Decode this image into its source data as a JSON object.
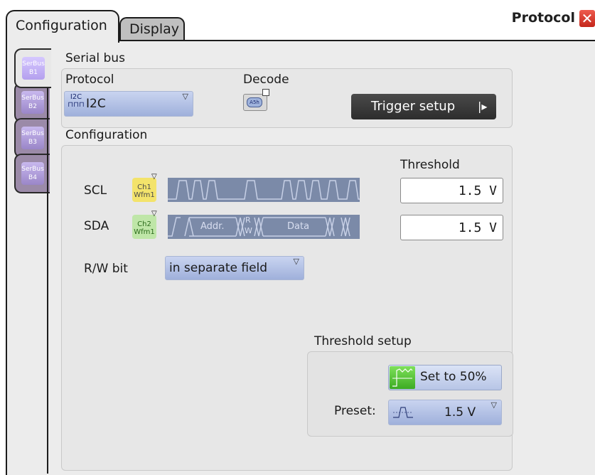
{
  "tabs": {
    "configuration": "Configuration",
    "display": "Display"
  },
  "window": {
    "title": "Protocol",
    "close": "✕"
  },
  "bus_tabs": [
    {
      "label": "SerBus\nB1"
    },
    {
      "label": "SerBus\nB2"
    },
    {
      "label": "SerBus\nB3"
    },
    {
      "label": "SerBus\nB4"
    }
  ],
  "serial_bus": {
    "section_title": "Serial bus",
    "protocol_label": "Protocol",
    "protocol_icon_text": "I2C",
    "protocol_value": "I2C",
    "decode_label": "Decode",
    "decode_icon_text": "A5h",
    "trigger_setup": "Trigger setup",
    "trigger_arrow": "|▸"
  },
  "configuration": {
    "section_title": "Configuration",
    "threshold_header": "Threshold",
    "scl_label": "SCL",
    "scl_icon_text": "Ch1\nWfm1",
    "scl_threshold": "1.5 V",
    "sda_label": "SDA",
    "sda_icon_text": "Ch2\nWfm1",
    "sda_wave_addr": "Addr.",
    "sda_wave_rw_r": "R",
    "sda_wave_rw_w": "W",
    "sda_wave_data": "Data",
    "sda_threshold": "1.5 V",
    "rw_label": "R/W bit",
    "rw_value": "in separate field"
  },
  "threshold_setup": {
    "title": "Threshold setup",
    "set50": "Set to 50%",
    "preset_label": "Preset:",
    "preset_value": "1.5 V"
  },
  "colors": {
    "accent_green": "#3cab23",
    "dropdown_blue": "#9fb0db",
    "wave_bg": "#7b8aa8",
    "close_red": "#d93a2b"
  }
}
